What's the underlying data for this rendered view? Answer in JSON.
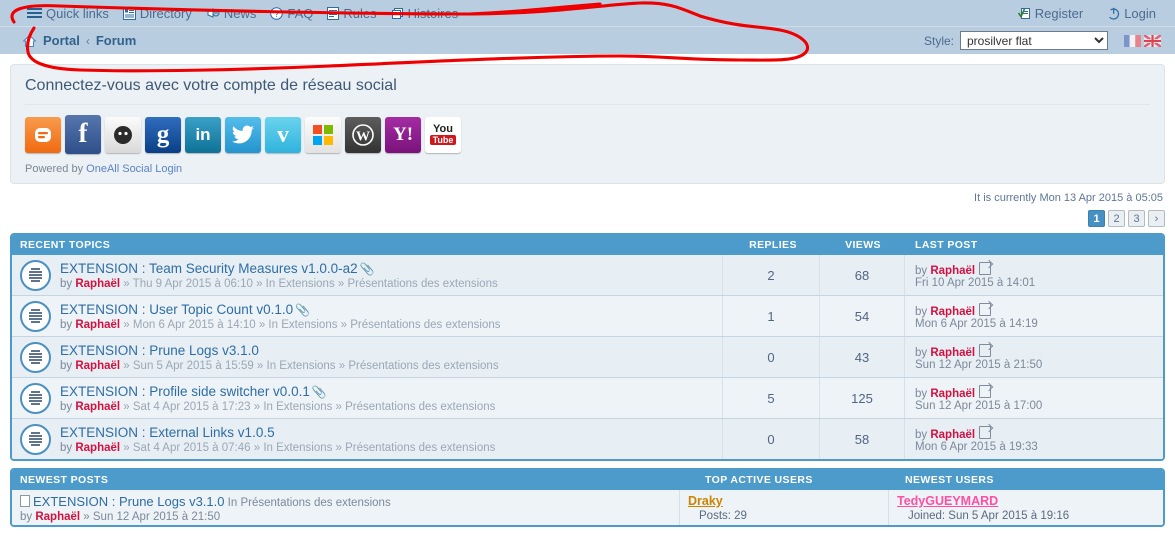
{
  "header": {
    "quick_links": "Quick links",
    "nav_items": [
      {
        "label": "Directory",
        "icon": "directory-icon"
      },
      {
        "label": "News",
        "icon": "megaphone-icon"
      },
      {
        "label": "FAQ",
        "icon": "question-icon"
      },
      {
        "label": "Rules",
        "icon": "document-icon"
      },
      {
        "label": "Histoires",
        "icon": "pages-icon"
      }
    ],
    "register": "Register",
    "login": "Login",
    "breadcrumb": {
      "home_icon": "home-icon",
      "portal": "Portal",
      "separator": "‹",
      "forum": "Forum"
    },
    "style_label": "Style:",
    "style_selected": "prosilver flat",
    "style_options": [
      "prosilver flat"
    ],
    "flags": [
      "fr-flag",
      "gb-flag"
    ]
  },
  "social": {
    "title": "Connectez-vous avec votre compte de réseau social",
    "powered_prefix": "Powered by ",
    "powered_link": "OneAll Social Login",
    "providers": [
      {
        "name": "blogger",
        "glyph": "b",
        "bg": "#f57d20",
        "fg": "#ffffff"
      },
      {
        "name": "facebook",
        "glyph": "f",
        "bg": "#3c5a98",
        "fg": "#ffffff"
      },
      {
        "name": "github",
        "glyph": "●",
        "bg": "#e9e9e9",
        "fg": "#2b2b2b"
      },
      {
        "name": "google",
        "glyph": "g",
        "bg": "#14509f",
        "fg": "#ffffff"
      },
      {
        "name": "linkedin",
        "glyph": "in",
        "bg": "#1b86b0",
        "fg": "#ffffff"
      },
      {
        "name": "twitter",
        "glyph": "✉",
        "bg": "#39a9dc",
        "fg": "#ffffff"
      },
      {
        "name": "vimeo",
        "glyph": "v",
        "bg": "#44bbde",
        "fg": "#ffffff"
      },
      {
        "name": "microsoft",
        "glyph": "■",
        "bg": "#eaeaea",
        "fg": "#f25022"
      },
      {
        "name": "wordpress",
        "glyph": "W",
        "bg": "#4a4a4a",
        "fg": "#ffffff"
      },
      {
        "name": "yahoo",
        "glyph": "Y!",
        "bg": "#8b1a8b",
        "fg": "#ffffff"
      },
      {
        "name": "youtube",
        "glyph": "You",
        "bg": "#ffffff",
        "fg": "#cc181e"
      }
    ]
  },
  "current_time": "It is currently Mon 13 Apr 2015 à 05:05",
  "pagination": {
    "pages": [
      "1",
      "2",
      "3"
    ],
    "active": "1",
    "next": "›"
  },
  "recent_topics": {
    "headers": {
      "title": "RECENT TOPICS",
      "replies": "REPLIES",
      "views": "VIEWS",
      "last_post": "LAST POST"
    },
    "rows": [
      {
        "title": "EXTENSION : Team Security Measures v1.0.0-a2",
        "has_attachment": true,
        "by": "by ",
        "author": "Raphaël",
        "meta": " » Thu 9 Apr 2015 à 06:10 » In Extensions » Présentations des extensions",
        "replies": "2",
        "views": "68",
        "last_by": "by ",
        "last_author": "Raphaël",
        "last_date": "Fri 10 Apr 2015 à 14:01"
      },
      {
        "title": "EXTENSION : User Topic Count v0.1.0",
        "has_attachment": true,
        "by": "by ",
        "author": "Raphaël",
        "meta": " » Mon 6 Apr 2015 à 14:10 » In Extensions » Présentations des extensions",
        "replies": "1",
        "views": "54",
        "last_by": "by ",
        "last_author": "Raphaël",
        "last_date": "Mon 6 Apr 2015 à 14:19"
      },
      {
        "title": "EXTENSION : Prune Logs v3.1.0",
        "has_attachment": false,
        "by": "by ",
        "author": "Raphaël",
        "meta": " » Sun 5 Apr 2015 à 15:59 » In Extensions » Présentations des extensions",
        "replies": "0",
        "views": "43",
        "last_by": "by ",
        "last_author": "Raphaël",
        "last_date": "Sun 12 Apr 2015 à 21:50"
      },
      {
        "title": "EXTENSION : Profile side switcher v0.0.1",
        "has_attachment": true,
        "by": "by ",
        "author": "Raphaël",
        "meta": " » Sat 4 Apr 2015 à 17:23 » In Extensions » Présentations des extensions",
        "replies": "5",
        "views": "125",
        "last_by": "by ",
        "last_author": "Raphaël",
        "last_date": "Sun 12 Apr 2015 à 17:00"
      },
      {
        "title": "EXTENSION : External Links v1.0.5",
        "has_attachment": false,
        "by": "by ",
        "author": "Raphaël",
        "meta": " » Sat 4 Apr 2015 à 07:46 » In Extensions » Présentations des extensions",
        "replies": "0",
        "views": "58",
        "last_by": "by ",
        "last_author": "Raphaël",
        "last_date": "Mon 6 Apr 2015 à 19:33"
      }
    ]
  },
  "bottom": {
    "headers": {
      "newest_posts": "NEWEST POSTS",
      "top_active_users": "TOP ACTIVE USERS",
      "newest_users": "NEWEST USERS"
    },
    "newest_post": {
      "title": "EXTENSION : Prune Logs v3.1.0",
      "forum": " In Présentations des extensions",
      "by": "by ",
      "author": "Raphaël",
      "meta": " » Sun 12 Apr 2015 à 21:50"
    },
    "top_active_user": {
      "name": "Draky",
      "stat": "Posts: 29"
    },
    "newest_user": {
      "name": "TedyGUEYMARD",
      "stat": "Joined: Sun 5 Apr 2015 à 19:16"
    }
  },
  "annotation": {
    "color": "#ee0000",
    "shape": "hand-drawn-ellipse-around-navbar"
  }
}
